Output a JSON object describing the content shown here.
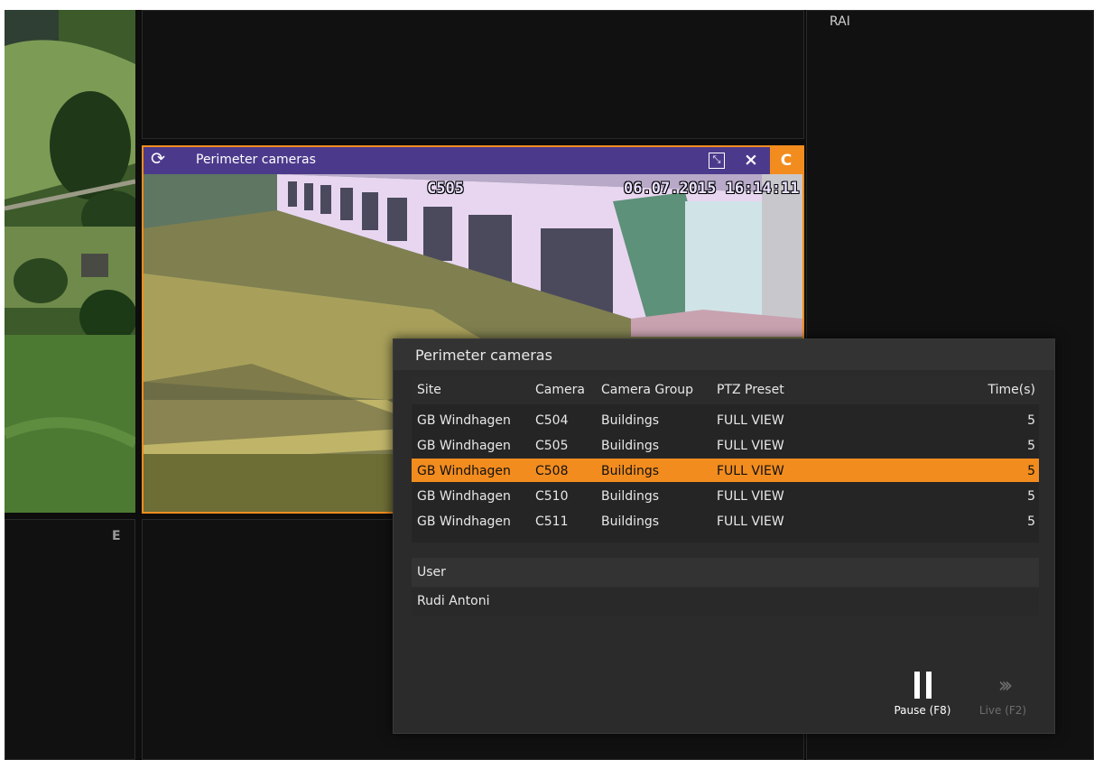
{
  "panes": {
    "right_top_label": "RAI",
    "left_bottom_label": "E"
  },
  "camera_tile": {
    "title": "Perimeter cameras",
    "badge": "C",
    "osd_camera": "C505",
    "osd_timestamp": "06.07.2015 16:14:11",
    "icons": {
      "refresh": "refresh-icon",
      "maximize": "maximize-icon",
      "close": "close-icon"
    }
  },
  "popup": {
    "title": "Perimeter cameras",
    "columns": {
      "site": "Site",
      "camera": "Camera",
      "group": "Camera Group",
      "ptz": "PTZ Preset",
      "time": "Time(s)"
    },
    "rows": [
      {
        "site": "GB Windhagen",
        "camera": "C504",
        "group": "Buildings",
        "ptz": "FULL VIEW",
        "time": "5"
      },
      {
        "site": "GB Windhagen",
        "camera": "C505",
        "group": "Buildings",
        "ptz": "FULL VIEW",
        "time": "5"
      },
      {
        "site": "GB Windhagen",
        "camera": "C508",
        "group": "Buildings",
        "ptz": "FULL VIEW",
        "time": "5"
      },
      {
        "site": "GB Windhagen",
        "camera": "C510",
        "group": "Buildings",
        "ptz": "FULL VIEW",
        "time": "5"
      },
      {
        "site": "GB Windhagen",
        "camera": "C511",
        "group": "Buildings",
        "ptz": "FULL VIEW",
        "time": "5"
      }
    ],
    "selected_row_index": 2,
    "user_header": "User",
    "user_value": "Rudi Antoni",
    "pause_label": "Pause (F8)",
    "live_label": "Live (F2)",
    "accent_color": "#f28c1e"
  }
}
